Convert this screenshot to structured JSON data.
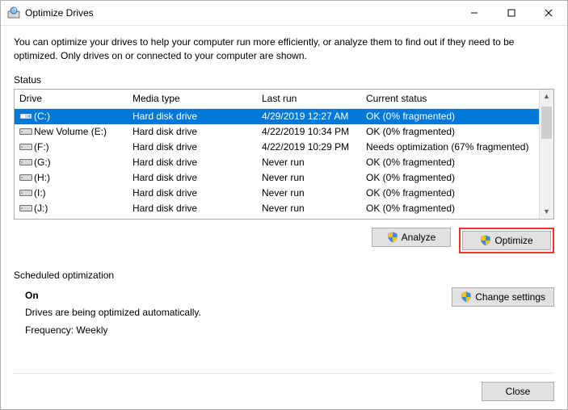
{
  "window": {
    "title": "Optimize Drives"
  },
  "intro": "You can optimize your drives to help your computer run more efficiently, or analyze them to find out if they need to be optimized. Only drives on or connected to your computer are shown.",
  "status_label": "Status",
  "columns": {
    "drive": "Drive",
    "media": "Media type",
    "last": "Last run",
    "status": "Current status"
  },
  "rows": [
    {
      "name": "(C:)",
      "media": "Hard disk drive",
      "last": "4/29/2019 12:27 AM",
      "status": "OK (0% fragmented)",
      "selected": true,
      "icon": "system"
    },
    {
      "name": "New Volume (E:)",
      "media": "Hard disk drive",
      "last": "4/22/2019 10:34 PM",
      "status": "OK (0% fragmented)",
      "icon": "hdd"
    },
    {
      "name": "(F:)",
      "media": "Hard disk drive",
      "last": "4/22/2019 10:29 PM",
      "status": "Needs optimization (67% fragmented)",
      "icon": "hdd"
    },
    {
      "name": "(G:)",
      "media": "Hard disk drive",
      "last": "Never run",
      "status": "OK (0% fragmented)",
      "icon": "hdd"
    },
    {
      "name": "(H:)",
      "media": "Hard disk drive",
      "last": "Never run",
      "status": "OK (0% fragmented)",
      "icon": "hdd"
    },
    {
      "name": "(I:)",
      "media": "Hard disk drive",
      "last": "Never run",
      "status": "OK (0% fragmented)",
      "icon": "hdd"
    },
    {
      "name": "(J:)",
      "media": "Hard disk drive",
      "last": "Never run",
      "status": "OK (0% fragmented)",
      "icon": "hdd"
    }
  ],
  "buttons": {
    "analyze": "Analyze",
    "optimize": "Optimize",
    "change": "Change settings",
    "close": "Close"
  },
  "sched": {
    "label": "Scheduled optimization",
    "on": "On",
    "line1": "Drives are being optimized automatically.",
    "line2": "Frequency: Weekly"
  }
}
